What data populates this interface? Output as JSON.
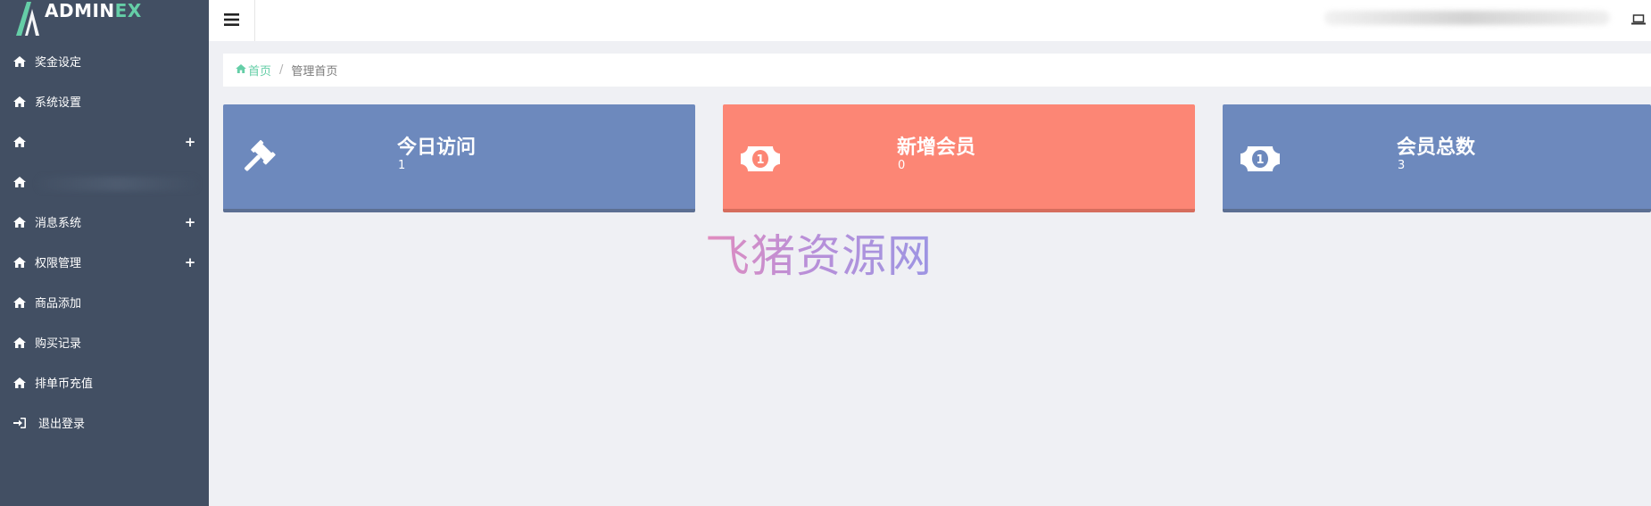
{
  "app": {
    "logo_text_main": "ADMIN",
    "logo_text_accent": "EX"
  },
  "sidebar": {
    "items": [
      {
        "label": "奖金设定",
        "icon": "home-icon",
        "expandable": false
      },
      {
        "label": "系统设置",
        "icon": "home-icon",
        "expandable": false
      },
      {
        "label": "",
        "icon": "home-icon",
        "expandable": true
      },
      {
        "label": "",
        "icon": "home-icon",
        "expandable": false
      },
      {
        "label": "消息系统",
        "icon": "home-icon",
        "expandable": true
      },
      {
        "label": "权限管理",
        "icon": "home-icon",
        "expandable": true
      },
      {
        "label": "商品添加",
        "icon": "home-icon",
        "expandable": false
      },
      {
        "label": "购买记录",
        "icon": "home-icon",
        "expandable": false
      },
      {
        "label": "排单币充值",
        "icon": "home-icon",
        "expandable": false
      },
      {
        "label": "退出登录",
        "icon": "sign-in-icon",
        "expandable": false
      }
    ],
    "expand_symbol": "+"
  },
  "header": {
    "toggle_icon": "bars-icon",
    "right_icon": "laptop-icon"
  },
  "breadcrumb": {
    "home": "首页",
    "separator": "/",
    "current": "管理首页"
  },
  "stats": [
    {
      "title": "今日访问",
      "value": "1",
      "icon": "gavel-icon",
      "color": "#6d89bd"
    },
    {
      "title": "新增会员",
      "value": "0",
      "icon": "money-icon",
      "color": "#fc8675"
    },
    {
      "title": "会员总数",
      "value": "3",
      "icon": "money-icon",
      "color": "#6d89bd"
    }
  ],
  "watermark": "飞猪资源网",
  "colors": {
    "sidebar_bg": "#424f63",
    "accent": "#65cea7",
    "blue_card": "#6d89bd",
    "red_card": "#fc8675",
    "page_bg": "#eff0f4"
  }
}
